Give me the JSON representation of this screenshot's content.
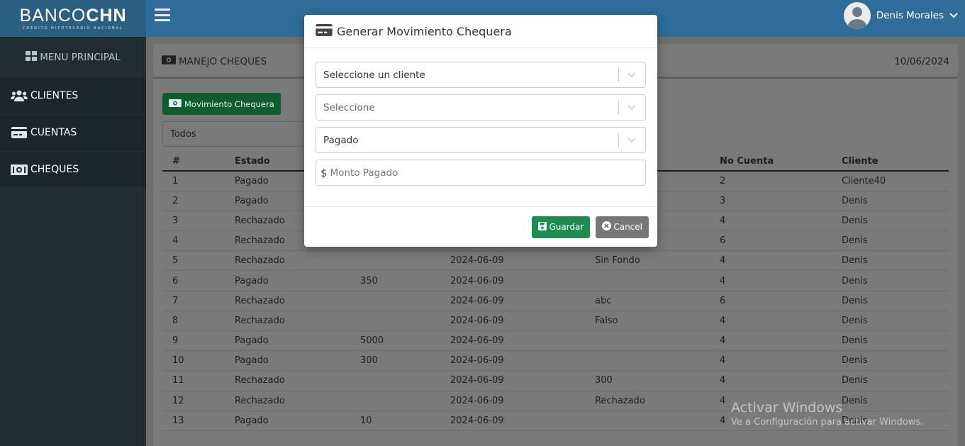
{
  "brand": {
    "title_light": "BANCO",
    "title_bold": "CHN",
    "subtitle": "CRÉDITO HIPOTECARIO NACIONAL"
  },
  "sidebar": {
    "header": "MENU PRINCIPAL",
    "items": [
      {
        "label": "CLIENTES",
        "icon": "users-icon"
      },
      {
        "label": "CUENTAS",
        "icon": "credit-card-icon"
      },
      {
        "label": "CHEQUES",
        "icon": "money-icon"
      }
    ]
  },
  "topbar": {
    "user_name": "Denis Morales"
  },
  "section": {
    "title": "MANEJO CHEQUES",
    "date": "10/06/2024"
  },
  "toolbar": {
    "movement_button": "Movimiento Chequera",
    "filter_value": "Todos"
  },
  "table": {
    "headers": [
      "#",
      "Estado",
      "",
      "",
      "",
      "No Cuenta",
      "Cliente"
    ],
    "rows": [
      [
        "1",
        "Pagado",
        "",
        "",
        "",
        "2",
        "Cliente40"
      ],
      [
        "2",
        "Pagado",
        "",
        "",
        "",
        "3",
        "Denis"
      ],
      [
        "3",
        "Rechazado",
        "",
        "",
        "",
        "4",
        "Denis"
      ],
      [
        "4",
        "Rechazado",
        "",
        "",
        "",
        "6",
        "Denis"
      ],
      [
        "5",
        "Rechazado",
        "",
        "2024-06-09",
        "Sin Fondo",
        "4",
        "Denis"
      ],
      [
        "6",
        "Pagado",
        "350",
        "2024-06-09",
        "",
        "4",
        "Denis"
      ],
      [
        "7",
        "Rechazado",
        "",
        "2024-06-09",
        "abc",
        "6",
        "Denis"
      ],
      [
        "8",
        "Rechazado",
        "",
        "2024-06-09",
        "Falso",
        "4",
        "Denis"
      ],
      [
        "9",
        "Pagado",
        "5000",
        "2024-06-09",
        "",
        "4",
        "Denis"
      ],
      [
        "10",
        "Pagado",
        "300",
        "2024-06-09",
        "",
        "4",
        "Denis"
      ],
      [
        "11",
        "Rechazado",
        "",
        "2024-06-09",
        "300",
        "4",
        "Denis"
      ],
      [
        "12",
        "Rechazado",
        "",
        "2024-06-09",
        "Rechazado",
        "4",
        "Denis"
      ],
      [
        "13",
        "Pagado",
        "10",
        "2024-06-09",
        "",
        "4",
        "Denis"
      ]
    ]
  },
  "modal": {
    "title": "Generar Movimiento Chequera",
    "select_client": "Seleccione un cliente",
    "select_account": "Seleccione",
    "select_status": "Pagado",
    "amount_placeholder": "Monto Pagado",
    "save_label": "Guardar",
    "cancel_label": "Cancel"
  },
  "watermark": {
    "line1": "Activar Windows",
    "line2": "Ve a Configuración para activar Windows."
  }
}
